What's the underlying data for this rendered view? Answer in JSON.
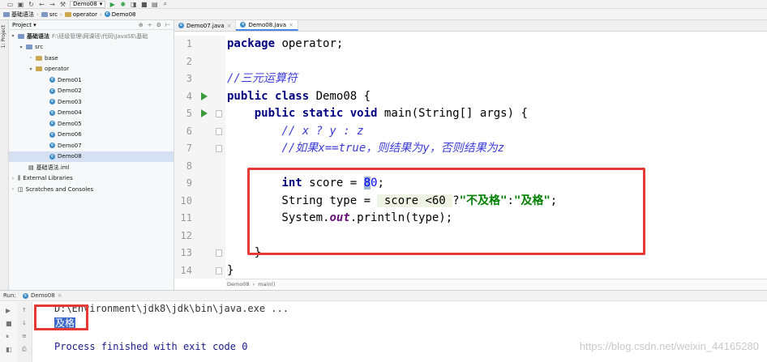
{
  "toolbar": {
    "run_config": "Demo08"
  },
  "navbar": {
    "crumbs": [
      "基础语法",
      "src",
      "operator",
      "Demo08"
    ]
  },
  "left_strip": {
    "label": "1: Project"
  },
  "project_panel": {
    "title": "Project",
    "root_label": "基础语法",
    "root_path": "F:\\班级管理\\网课班\\代码\\JavaSE\\基础",
    "src_label": "src",
    "base_label": "base",
    "operator_label": "operator",
    "classes": [
      "Demo01",
      "Demo02",
      "Demo03",
      "Demo04",
      "Demo05",
      "Demo06",
      "Demo07",
      "Demo08"
    ],
    "iml_label": "基础语法.iml",
    "external_libraries": "External Libraries",
    "scratches": "Scratches and Consoles"
  },
  "editor_tabs": [
    {
      "label": "Demo07.java",
      "active": false
    },
    {
      "label": "Demo08.java",
      "active": true
    }
  ],
  "editor": {
    "line_numbers": [
      "1",
      "2",
      "3",
      "4",
      "5",
      "6",
      "7",
      "8",
      "9",
      "10",
      "11",
      "12",
      "13",
      "14"
    ],
    "l1_kw": "package",
    "l1_rest": " operator;",
    "l3_comment": "//三元运算符",
    "l4_kw1": "public",
    "l4_kw2": "class",
    "l4_rest": " Demo08 {",
    "l5_indent": "    ",
    "l5_kw1": "public",
    "l5_kw2": "static",
    "l5_kw3": "void",
    "l5_rest": " main(String[] args) {",
    "l6_comment": "        // x ? y : z",
    "l7_comment": "        //如果x==true，则结果为y，否则结果为z",
    "l9_indent": "        ",
    "l9_kw": "int",
    "l9_mid": " score = ",
    "l9_cursor": "8",
    "l9_num": "0",
    "l9_end": ";",
    "l10_start": "        String type = ",
    "l10_expr": " score <60 ",
    "l10_q": "?",
    "l10_s1": "\"不及格\"",
    "l10_colon": ":",
    "l10_s2": "\"及格\"",
    "l10_end": ";",
    "l11_start": "        System.",
    "l11_field": "out",
    "l11_end": ".println(type);",
    "l13": "    }",
    "l14": "}"
  },
  "editor_breadcrumb": [
    "Demo08",
    "main()"
  ],
  "run_panel": {
    "label": "Run:",
    "tab": "Demo08",
    "cmd_line": "D:\\Environment\\jdk8\\jdk\\bin\\java.exe ...",
    "output": "及格",
    "finish": "Process finished with exit code 0"
  },
  "watermark": "https://blog.csdn.net/weixin_44165280"
}
